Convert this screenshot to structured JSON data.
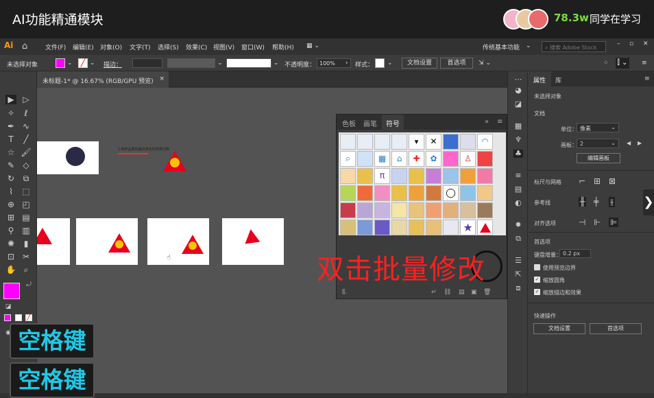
{
  "course": {
    "title": "AI功能精通模块",
    "learner_count": "78.3w",
    "learner_text": "同学在学习"
  },
  "menubar": {
    "logo": "Ai",
    "items": [
      "文件(F)",
      "编辑(E)",
      "对象(O)",
      "文字(T)",
      "选择(S)",
      "效果(C)",
      "视图(V)",
      "窗口(W)",
      "帮助(H)"
    ],
    "workspace": "传统基本功能",
    "search_placeholder": "搜索 Adobe Stock"
  },
  "controlbar": {
    "no_selection": "未选择对象",
    "stroke_label": "描边：",
    "opacity_label": "不透明度：",
    "opacity_value": "100%",
    "style_label": "样式：",
    "doc_setup": "文档设置",
    "preferences": "首选项"
  },
  "document": {
    "tab_title": "未标题-1* @ 16.67% (RGB/GPU 预览)",
    "tab_close": "×",
    "canvas_note": "1.制作品质的面对变化的背景切换"
  },
  "symbols_panel": {
    "tabs": [
      "色板",
      "画笔",
      "符号"
    ],
    "active_tab": "符号",
    "menu": "≡"
  },
  "overlay": {
    "instruction": "双击批量修改",
    "space_key": "空格键",
    "space_key_2": "空格键"
  },
  "properties": {
    "tabs": [
      "属性",
      "库"
    ],
    "no_selection": "未选择对象",
    "document_section": "文档",
    "unit_label": "单位：",
    "unit_value": "像素",
    "artboard_label": "画板：",
    "artboard_value": "2",
    "edit_artboard": "编辑画板",
    "rulers_grid": "标尺与网格",
    "guides": "参考线",
    "snap_options": "对齐选项",
    "prefs_section": "首选项",
    "keyboard_increment_label": "键盘增量：",
    "keyboard_increment_value": "0.2 px",
    "preview_bounds": "使用预览边界",
    "scale_corners": "缩放圆角",
    "scale_strokes": "缩放描边和效果",
    "quick_actions": "快速操作",
    "doc_setup_btn": "文档设置",
    "prefs_btn": "首选项"
  },
  "colors": {
    "fill": "#ff00ff",
    "triangle": "#e8001c",
    "star_circle": "#f5c400",
    "overlay_red": "#ff2020",
    "key_cyan": "#1ec8e8",
    "learner_green": "#7ddc3c"
  }
}
